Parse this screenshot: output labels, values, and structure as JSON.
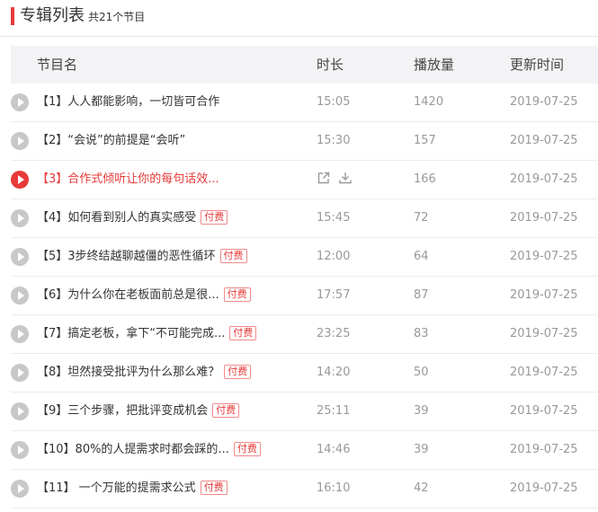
{
  "header": {
    "title": "专辑列表",
    "count": "共21个节目"
  },
  "table": {
    "columns": [
      "节目名",
      "时长",
      "播放量",
      "更新时间"
    ],
    "paid_tag": "付费",
    "rows": [
      {
        "name": "【1】人人都能影响，一切皆可合作",
        "duration": "15:05",
        "plays": "1420",
        "date": "2019-07-25",
        "paid": false,
        "active": false
      },
      {
        "name": "【2】“会说”的前提是“会听”",
        "duration": "15:30",
        "plays": "157",
        "date": "2019-07-25",
        "paid": false,
        "active": false
      },
      {
        "name": "【3】合作式倾听让你的每句话效...",
        "duration": "",
        "plays": "166",
        "date": "2019-07-25",
        "paid": false,
        "active": true
      },
      {
        "name": "【4】如何看到别人的真实感受",
        "duration": "15:45",
        "plays": "72",
        "date": "2019-07-25",
        "paid": true,
        "active": false
      },
      {
        "name": "【5】3步终结越聊越僵的恶性循环",
        "duration": "12:00",
        "plays": "64",
        "date": "2019-07-25",
        "paid": true,
        "active": false
      },
      {
        "name": "【6】为什么你在老板面前总是很...",
        "duration": "17:57",
        "plays": "87",
        "date": "2019-07-25",
        "paid": true,
        "active": false
      },
      {
        "name": "【7】搞定老板，拿下“不可能完成...",
        "duration": "23:25",
        "plays": "83",
        "date": "2019-07-25",
        "paid": true,
        "active": false
      },
      {
        "name": "【8】坦然接受批评为什么那么难？",
        "duration": "14:20",
        "plays": "50",
        "date": "2019-07-25",
        "paid": true,
        "active": false
      },
      {
        "name": "【9】三个步骤，把批评变成机会",
        "duration": "25:11",
        "plays": "39",
        "date": "2019-07-25",
        "paid": true,
        "active": false
      },
      {
        "name": "【10】80%的人提需求时都会踩的...",
        "duration": "14:46",
        "plays": "39",
        "date": "2019-07-25",
        "paid": true,
        "active": false
      },
      {
        "name": "【11】 一个万能的提需求公式",
        "duration": "16:10",
        "plays": "42",
        "date": "2019-07-25",
        "paid": true,
        "active": false
      }
    ]
  },
  "icons": {
    "play": "play-icon",
    "share": "share-icon",
    "download": "download-icon"
  },
  "colors": {
    "accent": "#e83a3a",
    "muted": "#999999",
    "header_bg": "#f3f3f5"
  }
}
